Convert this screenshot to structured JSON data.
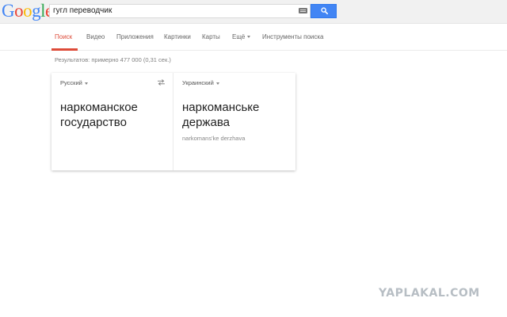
{
  "header": {
    "logo_letters": [
      "G",
      "o",
      "o",
      "g",
      "l",
      "e"
    ],
    "search": {
      "value": "гугл переводчик"
    }
  },
  "icons": {
    "keyboard": "keyboard-icon",
    "search": "search-icon",
    "swap": "swap-languages-icon",
    "dropdown": "caret-down-icon"
  },
  "colors": {
    "accent_blue": "#4285f4",
    "active_tab_red": "#dd4b39",
    "header_bg": "#f1f1f1"
  },
  "nav": {
    "items": [
      {
        "label": "Поиск",
        "active": true
      },
      {
        "label": "Видео"
      },
      {
        "label": "Приложения"
      },
      {
        "label": "Картинки"
      },
      {
        "label": "Карты"
      },
      {
        "label": "Ещё"
      },
      {
        "label": "Инструменты поиска"
      }
    ]
  },
  "results_stats": "Результатов: примерно 477 000 (0,31 сек.)",
  "translator": {
    "source": {
      "language": "Русский",
      "text_line1": "наркоманское",
      "text_line2": "государство"
    },
    "target": {
      "language": "Украинский",
      "text_line1": "наркоманське",
      "text_line2": "держава",
      "transliteration": "narkomans'ke derzhava"
    }
  },
  "watermark": "YAPLAKAL.COM"
}
